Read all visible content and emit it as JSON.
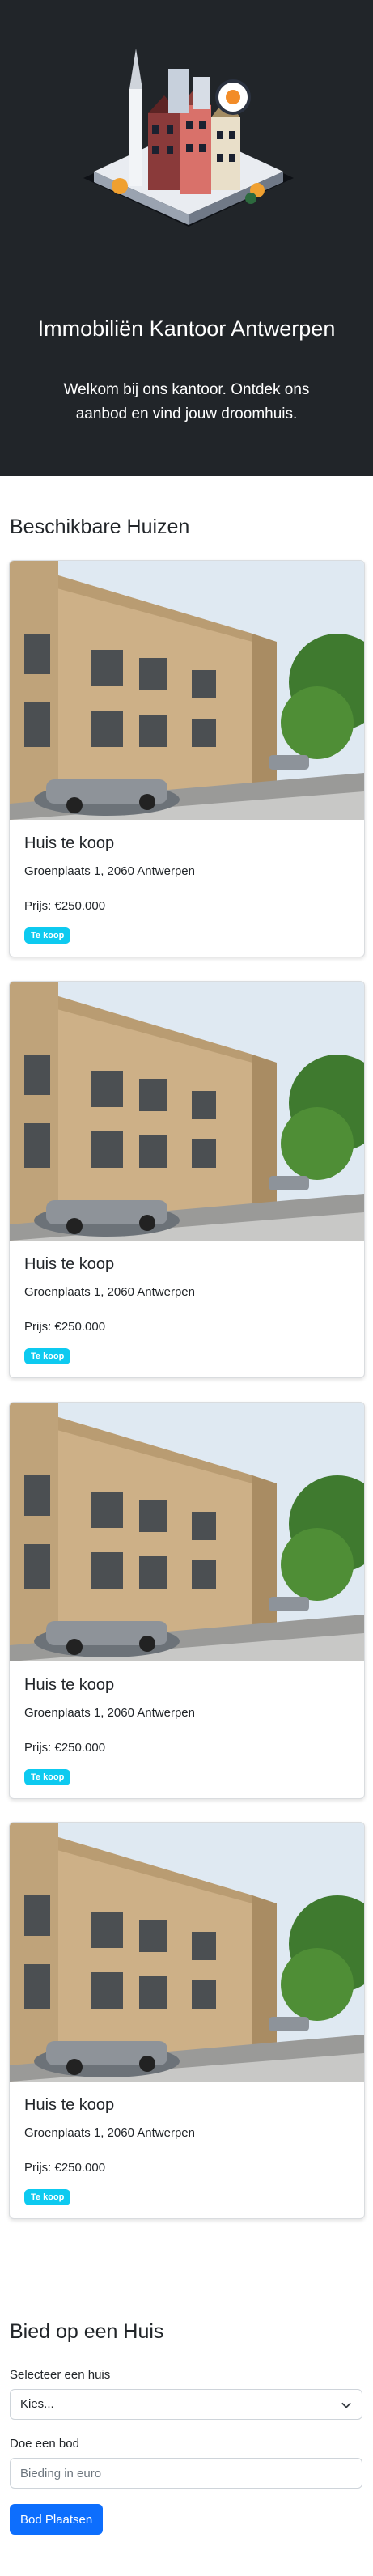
{
  "hero": {
    "title": "Immobiliën Kantoor Antwerpen",
    "lead": "Welkom bij ons kantoor. Ontdek ons aanbod en vind jouw droomhuis."
  },
  "listings": {
    "heading": "Beschikbare Huizen",
    "items": [
      {
        "title": "Huis te koop",
        "address": "Groenplaats 1, 2060 Antwerpen",
        "price": "Prijs: €250.000",
        "badge": "Te koop"
      },
      {
        "title": "Huis te koop",
        "address": "Groenplaats 1, 2060 Antwerpen",
        "price": "Prijs: €250.000",
        "badge": "Te koop"
      },
      {
        "title": "Huis te koop",
        "address": "Groenplaats 1, 2060 Antwerpen",
        "price": "Prijs: €250.000",
        "badge": "Te koop"
      },
      {
        "title": "Huis te koop",
        "address": "Groenplaats 1, 2060 Antwerpen",
        "price": "Prijs: €250.000",
        "badge": "Te koop"
      }
    ]
  },
  "bid": {
    "heading": "Bied op een Huis",
    "select_label": "Selecteer een huis",
    "select_value": "Kies...",
    "amount_label": "Doe een bod",
    "amount_placeholder": "Bieding in euro",
    "submit_label": "Bod Plaatsen"
  },
  "colors": {
    "hero_bg": "#212529",
    "primary": "#0d6efd",
    "badge_info": "#0dcaf0"
  }
}
